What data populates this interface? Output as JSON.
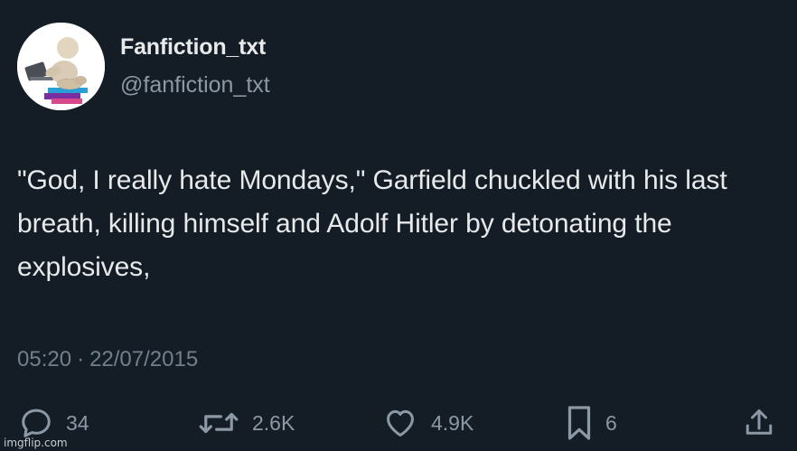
{
  "author": {
    "name": "Fanfiction_txt",
    "handle": "@fanfiction_txt"
  },
  "tweet": {
    "text": "\"God, I really hate Mondays,\" Garfield chuckled with his last breath, killing himself and Adolf Hitler by detonating the explosives,",
    "time": "05:20",
    "separator": "·",
    "date": "22/07/2015"
  },
  "actions": {
    "replies": "34",
    "reposts": "2.6K",
    "likes": "4.9K",
    "bookmarks": "6"
  },
  "icons": {
    "reply": "reply-icon",
    "repost": "repost-icon",
    "like": "heart-icon",
    "bookmark": "bookmark-icon",
    "share": "share-icon"
  },
  "watermark": "imgflip.com",
  "colors": {
    "background": "#141d26",
    "primary_text": "#e7e9ea",
    "secondary_text": "#8b98a5"
  }
}
